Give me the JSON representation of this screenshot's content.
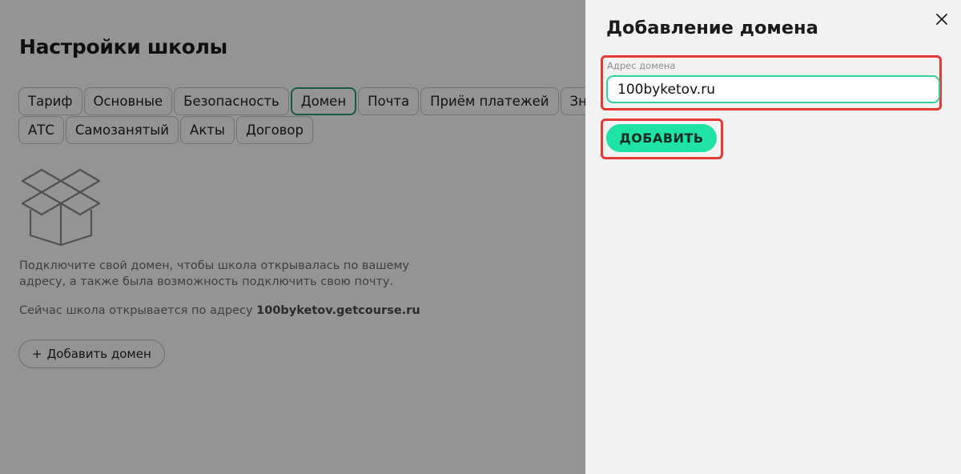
{
  "page": {
    "title": "Настройки школы",
    "tabs": [
      {
        "label": "Тариф",
        "active": false
      },
      {
        "label": "Основные",
        "active": false
      },
      {
        "label": "Безопасность",
        "active": false
      },
      {
        "label": "Домен",
        "active": true
      },
      {
        "label": "Почта",
        "active": false
      },
      {
        "label": "Приём платежей",
        "active": false
      },
      {
        "label": "Знак",
        "active": false
      },
      {
        "label": "АТС",
        "active": false
      },
      {
        "label": "Самозанятый",
        "active": false
      },
      {
        "label": "Акты",
        "active": false
      },
      {
        "label": "Договор",
        "active": false
      }
    ],
    "description": "Подключите свой домен, чтобы школа открывалась по вашему адресу, а также была возможность подключить свою почту.",
    "current_prefix": "Сейчас школа открывается по адресу",
    "current_domain": "100byketov.getcourse.ru",
    "add_domain_label": "Добавить домен",
    "add_domain_icon": "plus-icon"
  },
  "drawer": {
    "title": "Добавление домена",
    "close_icon": "close-icon",
    "field_label": "Адрес домена",
    "field_value": "100byketov.ru",
    "submit_label": "ДОБАВИТЬ"
  },
  "colors": {
    "accent": "#1fe3a5",
    "input_border": "#2fd1a0",
    "active_tab_border": "#2a9c6a",
    "highlight": "#e53935",
    "drawer_bg": "#f2f2f2"
  }
}
